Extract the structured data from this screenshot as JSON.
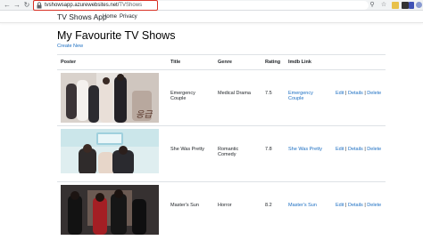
{
  "browser": {
    "url_host": "tvshowsapp.azurewebsites.net/",
    "url_path": "TVShows",
    "back_icon": "arrow-left-icon",
    "forward_icon": "arrow-right-icon",
    "reload_icon": "reload-icon"
  },
  "navbar": {
    "brand": "TV Shows App",
    "links": [
      "Home",
      "Privacy"
    ]
  },
  "page": {
    "title": "My Favourite TV Shows",
    "create_link": "Create New"
  },
  "table": {
    "headers": [
      "Poster",
      "Title",
      "Genre",
      "Rating",
      "Imdb Link"
    ],
    "action_labels": {
      "edit": "Edit",
      "details": "Details",
      "delete": "Delete"
    },
    "rows": [
      {
        "title": "Emergency Couple",
        "genre": "Medical Drama",
        "rating": "7.5",
        "imdb": "Emergency Couple"
      },
      {
        "title": "She Was Pretty",
        "genre": "Romantic Comedy",
        "rating": "7.8",
        "imdb": "She Was Pretty"
      },
      {
        "title": "Master's Sun",
        "genre": "Horror",
        "rating": "8.2",
        "imdb": "Master's Sun"
      }
    ]
  },
  "colors": {
    "link": "#1b6ec2",
    "url_highlight": "#d93025"
  }
}
